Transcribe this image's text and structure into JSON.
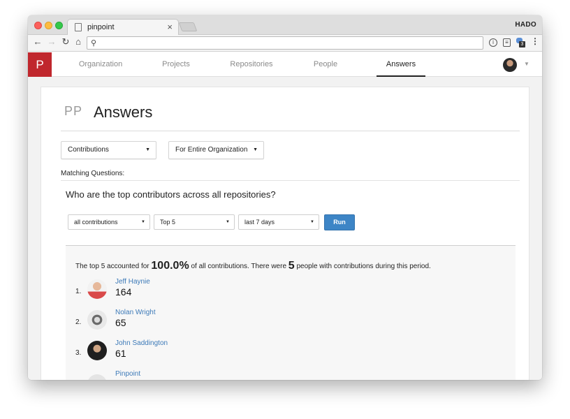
{
  "browser": {
    "tab_title": "pinpoint",
    "tab_close": "×",
    "profile_name": "HADO",
    "address": "",
    "nav_back": "←",
    "nav_forward": "→",
    "nav_reload": "↻",
    "nav_home": "⌂",
    "search_glyph": "⚲",
    "ext_info_glyph": "i",
    "ext_2_glyph": "≡",
    "ext_badge": "3",
    "menu_glyph": "⋮"
  },
  "app": {
    "logo_letter": "P",
    "nav": [
      "Organization",
      "Projects",
      "Repositories",
      "People",
      "Answers"
    ],
    "active_nav": "Answers",
    "brand_color": "#c0272d",
    "caret": "▼"
  },
  "page": {
    "org_initials": "PP",
    "title": "Answers",
    "filter_contributions": "Contributions",
    "filter_scope": "For Entire Organization",
    "matching_label": "Matching Questions:",
    "question": "Who are the top contributors across all repositories?",
    "select_kind": "all contributions",
    "select_top": "Top 5",
    "select_period": "last 7 days",
    "run_label": "Run",
    "run_color": "#3d85c6"
  },
  "result": {
    "summary_prefix": "The top 5 accounted for",
    "percent": "100.0%",
    "summary_middle": "of all contributions. There were",
    "people_count": "5",
    "summary_suffix": "people with contributions during this period.",
    "link_color": "#3d7ab8",
    "contributors": [
      {
        "rank": "1.",
        "name": "Jeff Haynie",
        "count": "164"
      },
      {
        "rank": "2.",
        "name": "Nolan Wright",
        "count": "65"
      },
      {
        "rank": "3.",
        "name": "John Saddington",
        "count": "61"
      },
      {
        "rank": "",
        "name": "Pinpoint",
        "count": ""
      }
    ]
  }
}
